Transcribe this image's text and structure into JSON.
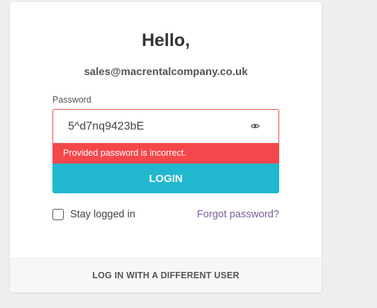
{
  "login": {
    "greeting": "Hello,",
    "email": "sales@macrentalcompany.co.uk",
    "password_label": "Password",
    "password_value": "5^d7nq9423bE",
    "error_message": "Provided password is incorrect.",
    "login_button": "LOGIN",
    "stay_logged_in_label": "Stay logged in",
    "stay_logged_in_checked": false,
    "forgot_password_link": "Forgot password?",
    "different_user_link": "LOG IN WITH A DIFFERENT USER"
  },
  "icons": {
    "password_toggle": "eye-icon"
  },
  "colors": {
    "page_background": "#efefef",
    "error": "#f4474b",
    "primary_button": "#21b8cf",
    "link": "#7a5f9f"
  }
}
